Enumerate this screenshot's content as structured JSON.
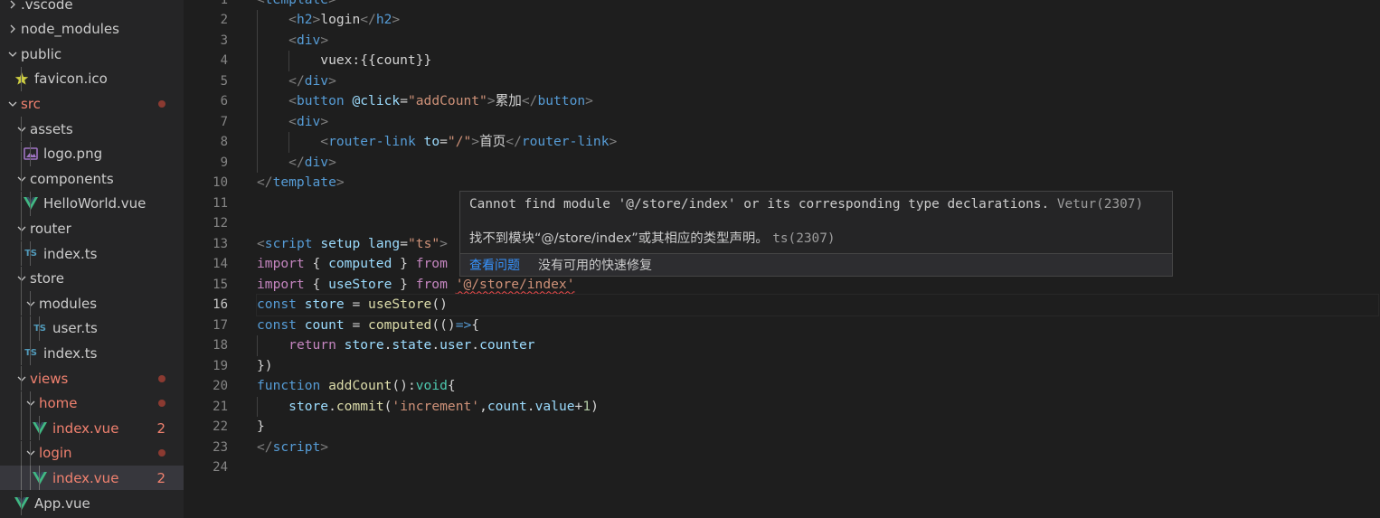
{
  "explorer": {
    "items": [
      {
        "label": ".vscode",
        "depth": 0,
        "kind": "folder",
        "open": false
      },
      {
        "label": "node_modules",
        "depth": 0,
        "kind": "folder",
        "open": false
      },
      {
        "label": "public",
        "depth": 0,
        "kind": "folder",
        "open": true
      },
      {
        "label": "favicon.ico",
        "depth": 1,
        "kind": "favicon"
      },
      {
        "label": "src",
        "depth": 0,
        "kind": "folder",
        "open": true,
        "modified": true,
        "dot": true
      },
      {
        "label": "assets",
        "depth": 1,
        "kind": "folder",
        "open": true
      },
      {
        "label": "logo.png",
        "depth": 2,
        "kind": "image"
      },
      {
        "label": "components",
        "depth": 1,
        "kind": "folder",
        "open": true
      },
      {
        "label": "HelloWorld.vue",
        "depth": 2,
        "kind": "vue"
      },
      {
        "label": "router",
        "depth": 1,
        "kind": "folder",
        "open": true
      },
      {
        "label": "index.ts",
        "depth": 2,
        "kind": "ts",
        "icon_text": "TS"
      },
      {
        "label": "store",
        "depth": 1,
        "kind": "folder",
        "open": true
      },
      {
        "label": "modules",
        "depth": 2,
        "kind": "folder",
        "open": true
      },
      {
        "label": "user.ts",
        "depth": 3,
        "kind": "ts",
        "icon_text": "TS"
      },
      {
        "label": "index.ts",
        "depth": 2,
        "kind": "ts",
        "icon_text": "TS"
      },
      {
        "label": "views",
        "depth": 1,
        "kind": "folder",
        "open": true,
        "modified": true,
        "dot": true
      },
      {
        "label": "home",
        "depth": 2,
        "kind": "folder",
        "open": true,
        "modified": true,
        "dot": true
      },
      {
        "label": "index.vue",
        "depth": 3,
        "kind": "vue",
        "modified": true,
        "badge": "2"
      },
      {
        "label": "login",
        "depth": 2,
        "kind": "folder",
        "open": true,
        "modified": true,
        "dot": true
      },
      {
        "label": "index.vue",
        "depth": 3,
        "kind": "vue",
        "modified": true,
        "badge": "2",
        "selected": true
      },
      {
        "label": "App.vue",
        "depth": 1,
        "kind": "vue"
      }
    ]
  },
  "editor": {
    "active_line": 16,
    "lines": [
      [
        [
          "t-br",
          "<"
        ],
        [
          "t-tag",
          "template"
        ],
        [
          "t-br",
          ">"
        ]
      ],
      [
        [
          "t-txt",
          "    "
        ],
        [
          "t-br",
          "<"
        ],
        [
          "t-tag",
          "h2"
        ],
        [
          "t-br",
          ">"
        ],
        [
          "t-txt",
          "login"
        ],
        [
          "t-br",
          "</"
        ],
        [
          "t-tag",
          "h2"
        ],
        [
          "t-br",
          ">"
        ]
      ],
      [
        [
          "t-txt",
          "    "
        ],
        [
          "t-br",
          "<"
        ],
        [
          "t-tag",
          "div"
        ],
        [
          "t-br",
          ">"
        ]
      ],
      [
        [
          "t-txt",
          "        vuex:{{count}}"
        ]
      ],
      [
        [
          "t-txt",
          "    "
        ],
        [
          "t-br",
          "</"
        ],
        [
          "t-tag",
          "div"
        ],
        [
          "t-br",
          ">"
        ]
      ],
      [
        [
          "t-txt",
          "    "
        ],
        [
          "t-br",
          "<"
        ],
        [
          "t-tag",
          "button"
        ],
        [
          "t-txt",
          " "
        ],
        [
          "t-attr",
          "@click"
        ],
        [
          "t-txt",
          "="
        ],
        [
          "t-str",
          "\"addCount\""
        ],
        [
          "t-br",
          ">"
        ],
        [
          "t-txt",
          "累加"
        ],
        [
          "t-br",
          "</"
        ],
        [
          "t-tag",
          "button"
        ],
        [
          "t-br",
          ">"
        ]
      ],
      [
        [
          "t-txt",
          "    "
        ],
        [
          "t-br",
          "<"
        ],
        [
          "t-tag",
          "div"
        ],
        [
          "t-br",
          ">"
        ]
      ],
      [
        [
          "t-txt",
          "        "
        ],
        [
          "t-br",
          "<"
        ],
        [
          "t-tag",
          "router-link"
        ],
        [
          "t-txt",
          " "
        ],
        [
          "t-attr",
          "to"
        ],
        [
          "t-txt",
          "="
        ],
        [
          "t-str",
          "\"/\""
        ],
        [
          "t-br",
          ">"
        ],
        [
          "t-txt",
          "首页"
        ],
        [
          "t-br",
          "</"
        ],
        [
          "t-tag",
          "router-link"
        ],
        [
          "t-br",
          ">"
        ]
      ],
      [
        [
          "t-txt",
          "    "
        ],
        [
          "t-br",
          "</"
        ],
        [
          "t-tag",
          "div"
        ],
        [
          "t-br",
          ">"
        ]
      ],
      [
        [
          "t-br",
          "</"
        ],
        [
          "t-tag",
          "template"
        ],
        [
          "t-br",
          ">"
        ]
      ],
      [],
      [],
      [
        [
          "t-br",
          "<"
        ],
        [
          "t-tag",
          "script"
        ],
        [
          "t-txt",
          " "
        ],
        [
          "t-attr",
          "setup"
        ],
        [
          "t-txt",
          " "
        ],
        [
          "t-attr",
          "lang"
        ],
        [
          "t-txt",
          "="
        ],
        [
          "t-str",
          "\"ts\""
        ],
        [
          "t-br",
          ">"
        ]
      ],
      [
        [
          "t-kw",
          "import"
        ],
        [
          "t-txt",
          " { "
        ],
        [
          "t-var",
          "computed"
        ],
        [
          "t-txt",
          " } "
        ],
        [
          "t-kw",
          "from"
        ]
      ],
      [
        [
          "t-kw",
          "import"
        ],
        [
          "t-txt",
          " { "
        ],
        [
          "t-var",
          "useStore"
        ],
        [
          "t-txt",
          " } "
        ],
        [
          "t-kw",
          "from"
        ],
        [
          "t-txt",
          " "
        ],
        [
          "t-str squiggle",
          "'@/store/index'"
        ]
      ],
      [
        [
          "t-dec",
          "const"
        ],
        [
          "t-txt",
          " "
        ],
        [
          "t-var",
          "store"
        ],
        [
          "t-txt",
          " = "
        ],
        [
          "t-fn",
          "useStore"
        ],
        [
          "t-txt",
          "()"
        ]
      ],
      [
        [
          "t-dec",
          "const"
        ],
        [
          "t-txt",
          " "
        ],
        [
          "t-var",
          "count"
        ],
        [
          "t-txt",
          " = "
        ],
        [
          "t-fn",
          "computed"
        ],
        [
          "t-txt",
          "(()"
        ],
        [
          "t-dec",
          "=>"
        ],
        [
          "t-txt",
          "{"
        ]
      ],
      [
        [
          "t-txt",
          "    "
        ],
        [
          "t-kw",
          "return"
        ],
        [
          "t-txt",
          " "
        ],
        [
          "t-var",
          "store"
        ],
        [
          "t-txt",
          "."
        ],
        [
          "t-var",
          "state"
        ],
        [
          "t-txt",
          "."
        ],
        [
          "t-var",
          "user"
        ],
        [
          "t-txt",
          "."
        ],
        [
          "t-var",
          "counter"
        ]
      ],
      [
        [
          "t-txt",
          "})"
        ]
      ],
      [
        [
          "t-dec",
          "function"
        ],
        [
          "t-txt",
          " "
        ],
        [
          "t-fn",
          "addCount"
        ],
        [
          "t-txt",
          "():"
        ],
        [
          "t-type",
          "void"
        ],
        [
          "t-txt",
          "{"
        ]
      ],
      [
        [
          "t-txt",
          "    "
        ],
        [
          "t-var",
          "store"
        ],
        [
          "t-txt",
          "."
        ],
        [
          "t-fn",
          "commit"
        ],
        [
          "t-txt",
          "("
        ],
        [
          "t-str",
          "'increment'"
        ],
        [
          "t-txt",
          ","
        ],
        [
          "t-var",
          "count"
        ],
        [
          "t-txt",
          "."
        ],
        [
          "t-var",
          "value"
        ],
        [
          "t-txt",
          "+"
        ],
        [
          "t-num",
          "1"
        ],
        [
          "t-txt",
          ")"
        ]
      ],
      [
        [
          "t-txt",
          "}"
        ]
      ],
      [
        [
          "t-br",
          "</"
        ],
        [
          "t-tag",
          "script"
        ],
        [
          "t-br",
          ">"
        ]
      ],
      []
    ]
  },
  "hover": {
    "message_en": "Cannot find module '@/store/index' or its corresponding type declarations.",
    "source_en": "Vetur(2307)",
    "message_zh": "找不到模块“@/store/index”或其相应的类型声明。",
    "source_zh": "ts(2307)",
    "view_problem": "查看问题",
    "no_quick_fix": "没有可用的快速修复"
  },
  "colors": {
    "vue_icon": "#41b883",
    "favicon_star": "#cbcb41",
    "image_icon": "#a074c4",
    "ts_icon": "#519aba",
    "modified_text": "#f0816f",
    "error_squiggle": "#f14c4c"
  }
}
